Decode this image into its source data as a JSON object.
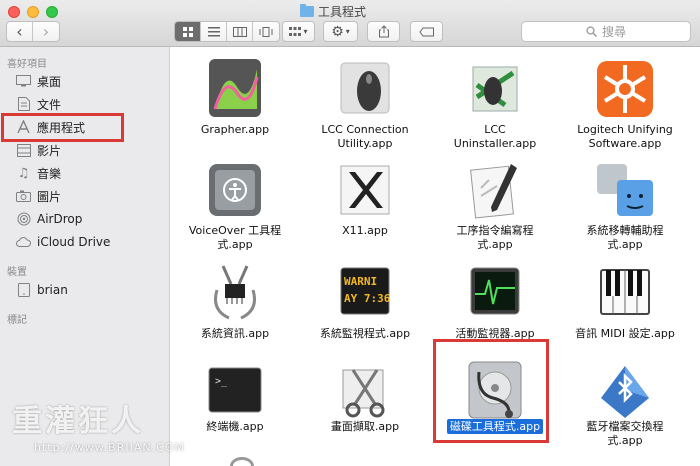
{
  "window": {
    "title": "工具程式"
  },
  "toolbar": {
    "back": "‹",
    "forward": "›",
    "search_placeholder": "搜尋"
  },
  "sidebar": {
    "favorites_header": "喜好項目",
    "favorites": [
      {
        "label": "桌面",
        "icon": "desktop-icon"
      },
      {
        "label": "文件",
        "icon": "documents-icon"
      },
      {
        "label": "應用程式",
        "icon": "applications-icon"
      },
      {
        "label": "影片",
        "icon": "movies-icon"
      },
      {
        "label": "音樂",
        "icon": "music-icon"
      },
      {
        "label": "圖片",
        "icon": "pictures-icon"
      },
      {
        "label": "AirDrop",
        "icon": "airdrop-icon"
      },
      {
        "label": "iCloud Drive",
        "icon": "icloud-icon"
      }
    ],
    "devices_header": "裝置",
    "devices": [
      {
        "label": "brian",
        "icon": "harddisk-icon"
      }
    ],
    "tags_header": "標記"
  },
  "apps": [
    {
      "line1": "Grapher.app",
      "line2": ""
    },
    {
      "line1": "LCC Connection",
      "line2": "Utility.app"
    },
    {
      "line1": "LCC",
      "line2": "Uninstaller.app"
    },
    {
      "line1": "Logitech Unifying",
      "line2": "Software.app"
    },
    {
      "line1": "VoiceOver 工具程",
      "line2": "式.app"
    },
    {
      "line1": "X11.app",
      "line2": ""
    },
    {
      "line1": "工序指令編寫程",
      "line2": "式.app"
    },
    {
      "line1": "系統移轉輔助程",
      "line2": "式.app"
    },
    {
      "line1": "系統資訊.app",
      "line2": ""
    },
    {
      "line1": "系統監視程式.app",
      "line2": ""
    },
    {
      "line1": "活動監視器.app",
      "line2": ""
    },
    {
      "line1": "音訊 MIDI 設定.app",
      "line2": ""
    },
    {
      "line1": "終端機.app",
      "line2": ""
    },
    {
      "line1": "畫面擷取.app",
      "line2": ""
    },
    {
      "line1": "磁碟工具程式.app",
      "line2": ""
    },
    {
      "line1": "藍牙檔案交換程",
      "line2": "式.app"
    }
  ],
  "watermark": {
    "text": "重灌狂人",
    "url": "http://www.BRIIAN.COM"
  },
  "colors": {
    "selection": "#1a6ddb",
    "highlight_box": "#d93a36"
  }
}
